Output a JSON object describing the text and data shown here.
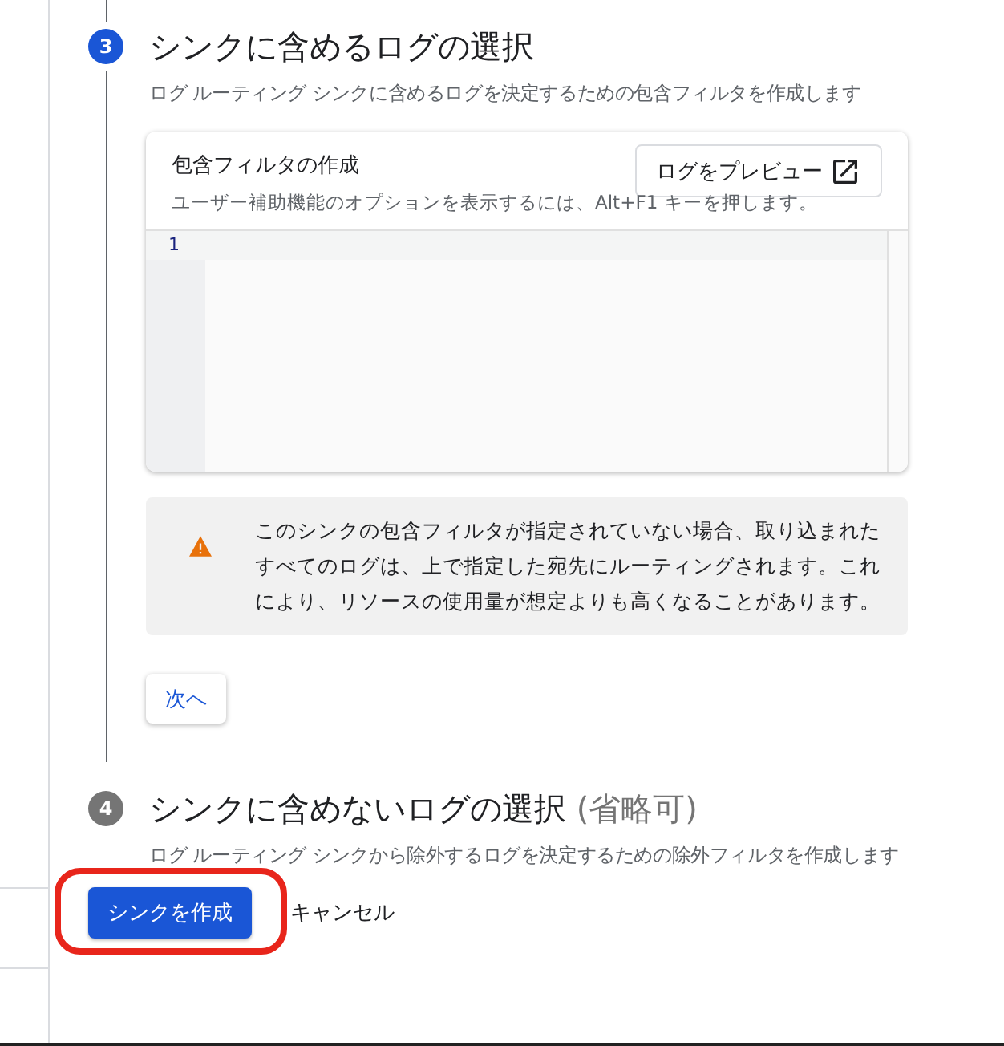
{
  "steps": [
    {
      "number": "3",
      "title": "シンクに含めるログの選択",
      "selected": true,
      "description": "ログ ルーティング シンクに含めるログを決定するための包含フィルタを作成します",
      "filter_card": {
        "title": "包含フィルタの作成",
        "hint": "ユーザー補助機能のオプションを表示するには、Alt+F1 キーを押します。",
        "preview_button": "ログをプレビュー",
        "line_numbers": [
          "1"
        ]
      },
      "warning": "このシンクの包含フィルタが指定されていない場合、取り込まれたすべてのログは、上で指定した宛先にルーティングされます。これにより、リソースの使用量が想定よりも高くなることがあります。",
      "next_button": "次へ"
    },
    {
      "number": "4",
      "title": "シンクに含めないログの選択",
      "optional": "(省略可)",
      "selected": false,
      "description": "ログ ルーティング シンクから除外するログを決定するための除外フィルタを作成します"
    }
  ],
  "actions": {
    "create_button": "シンクを作成",
    "highlighted": true,
    "cancel_button": "キャンセル"
  }
}
